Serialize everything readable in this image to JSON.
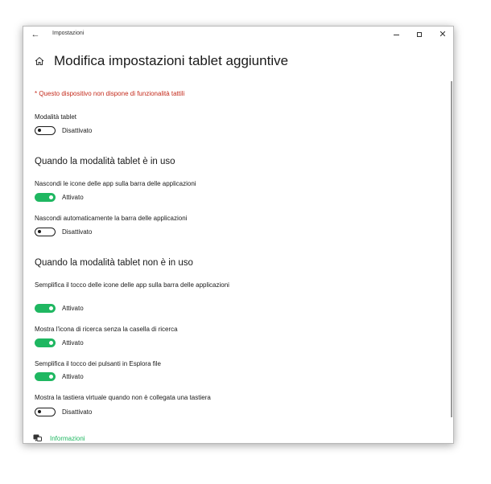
{
  "window": {
    "title": "Impostazioni",
    "back_glyph": "←",
    "close_glyph": "✕"
  },
  "header": {
    "title": "Modifica impostazioni tablet aggiuntive",
    "icon": "home-icon"
  },
  "note": "* Questo dispositivo non dispone di funzionalità tattili",
  "tablet_mode": {
    "label": "Modalità tablet",
    "state": "Disattivato",
    "on": false
  },
  "section_in_use": {
    "heading": "Quando la modalità tablet è in uso",
    "settings": [
      {
        "label": "Nascondi le icone delle app sulla barra delle applicazioni",
        "state": "Attivato",
        "on": true
      },
      {
        "label": "Nascondi automaticamente la barra delle applicazioni",
        "state": "Disattivato",
        "on": false
      }
    ]
  },
  "section_not_in_use": {
    "heading": "Quando la modalità tablet non è in uso",
    "settings": [
      {
        "label": "Semplifica il tocco delle icone delle app sulla barra delle applicazioni",
        "state": "Attivato",
        "on": true
      },
      {
        "label": "Mostra l'icona di ricerca senza la casella di ricerca",
        "state": "Attivato",
        "on": true
      },
      {
        "label": "Semplifica il tocco dei pulsanti in Esplora file",
        "state": "Attivato",
        "on": true
      },
      {
        "label": "Mostra la tastiera virtuale quando non è collegata una tastiera",
        "state": "Disattivato",
        "on": false
      }
    ]
  },
  "footer": {
    "info_label": "Informazioni",
    "icon": "info-icon"
  },
  "colors": {
    "accent": "#1fb761",
    "warning": "#c42b1c"
  }
}
